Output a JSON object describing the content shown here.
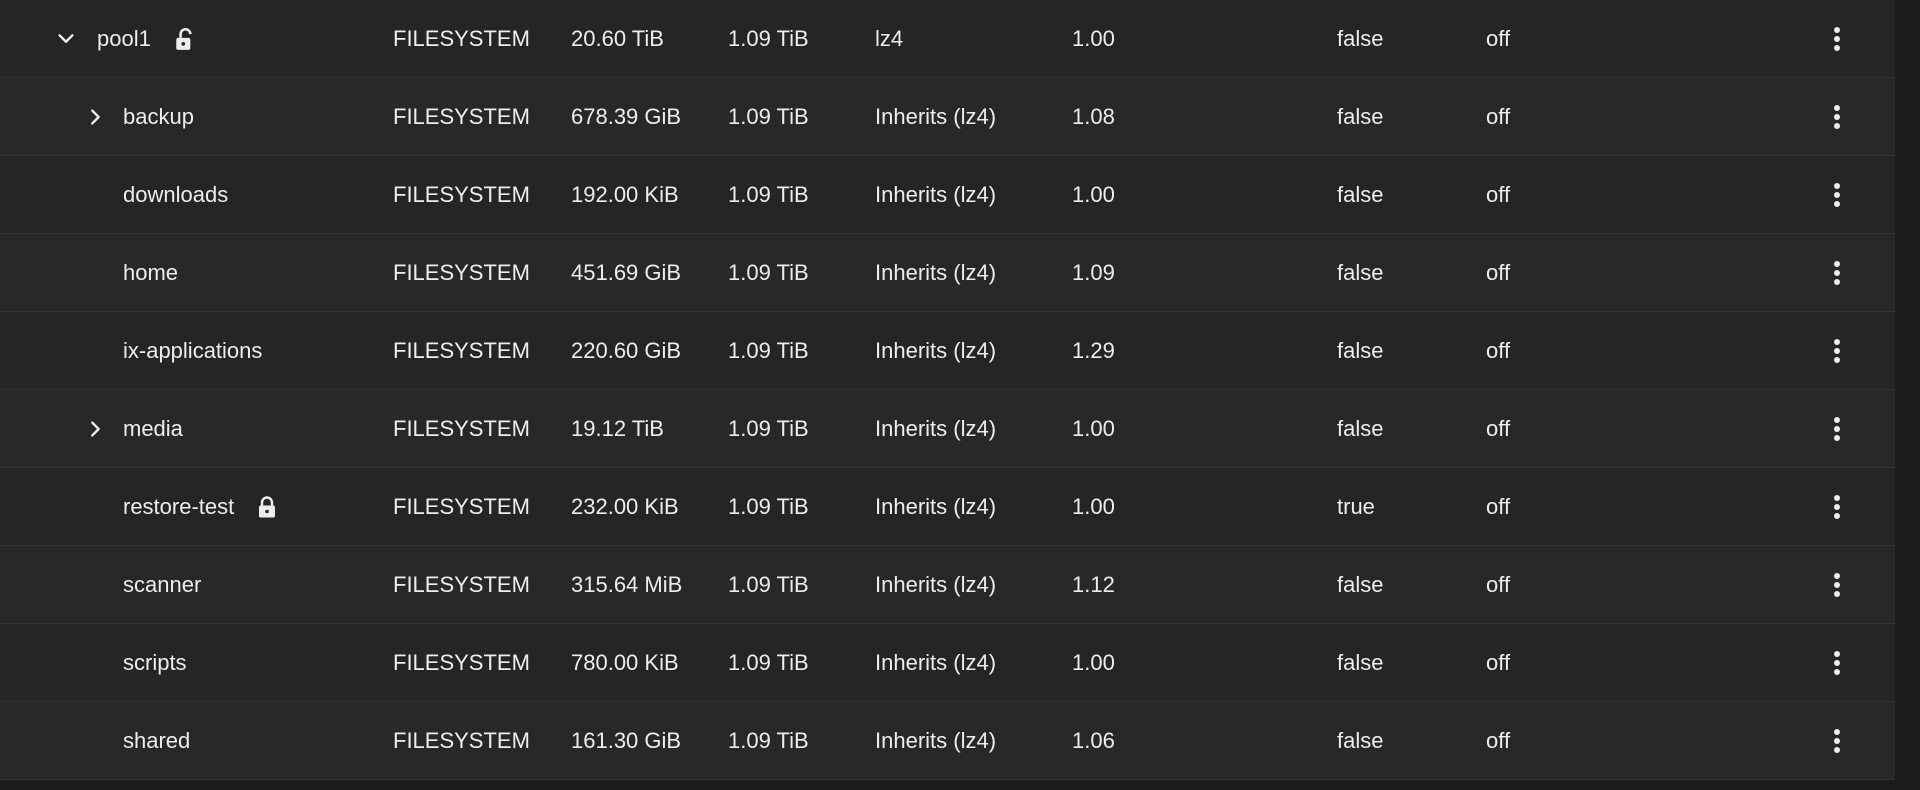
{
  "rows": [
    {
      "name": "pool1",
      "toggle": "expanded",
      "lock": "unlocked",
      "type": "FILESYSTEM",
      "used": "20.60 TiB",
      "available": "1.09 TiB",
      "compression": "lz4",
      "ratio": "1.00",
      "readonly": "false",
      "dedup": "off"
    },
    {
      "name": "backup",
      "toggle": "collapsed",
      "lock": "",
      "type": "FILESYSTEM",
      "used": "678.39 GiB",
      "available": "1.09 TiB",
      "compression": "Inherits (lz4)",
      "ratio": "1.08",
      "readonly": "false",
      "dedup": "off"
    },
    {
      "name": "downloads",
      "toggle": "",
      "lock": "",
      "type": "FILESYSTEM",
      "used": "192.00 KiB",
      "available": "1.09 TiB",
      "compression": "Inherits (lz4)",
      "ratio": "1.00",
      "readonly": "false",
      "dedup": "off"
    },
    {
      "name": "home",
      "toggle": "",
      "lock": "",
      "type": "FILESYSTEM",
      "used": "451.69 GiB",
      "available": "1.09 TiB",
      "compression": "Inherits (lz4)",
      "ratio": "1.09",
      "readonly": "false",
      "dedup": "off"
    },
    {
      "name": "ix-applications",
      "toggle": "",
      "lock": "",
      "type": "FILESYSTEM",
      "used": "220.60 GiB",
      "available": "1.09 TiB",
      "compression": "Inherits (lz4)",
      "ratio": "1.29",
      "readonly": "false",
      "dedup": "off"
    },
    {
      "name": "media",
      "toggle": "collapsed",
      "lock": "",
      "type": "FILESYSTEM",
      "used": "19.12 TiB",
      "available": "1.09 TiB",
      "compression": "Inherits (lz4)",
      "ratio": "1.00",
      "readonly": "false",
      "dedup": "off"
    },
    {
      "name": "restore-test",
      "toggle": "",
      "lock": "locked",
      "type": "FILESYSTEM",
      "used": "232.00 KiB",
      "available": "1.09 TiB",
      "compression": "Inherits (lz4)",
      "ratio": "1.00",
      "readonly": "true",
      "dedup": "off"
    },
    {
      "name": "scanner",
      "toggle": "",
      "lock": "",
      "type": "FILESYSTEM",
      "used": "315.64 MiB",
      "available": "1.09 TiB",
      "compression": "Inherits (lz4)",
      "ratio": "1.12",
      "readonly": "false",
      "dedup": "off"
    },
    {
      "name": "scripts",
      "toggle": "",
      "lock": "",
      "type": "FILESYSTEM",
      "used": "780.00 KiB",
      "available": "1.09 TiB",
      "compression": "Inherits (lz4)",
      "ratio": "1.00",
      "readonly": "false",
      "dedup": "off"
    },
    {
      "name": "shared",
      "toggle": "",
      "lock": "",
      "type": "FILESYSTEM",
      "used": "161.30 GiB",
      "available": "1.09 TiB",
      "compression": "Inherits (lz4)",
      "ratio": "1.06",
      "readonly": "false",
      "dedup": "off"
    }
  ]
}
